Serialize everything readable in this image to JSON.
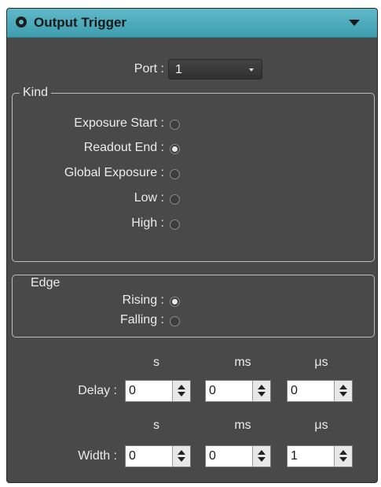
{
  "header": {
    "title": "Output Trigger",
    "icon": "gear-circle-icon",
    "collapse_icon": "triangle-down-icon"
  },
  "port": {
    "label": "Port :",
    "value": "1"
  },
  "kind": {
    "title": "Kind",
    "options": [
      {
        "label": "Exposure Start :",
        "selected": false
      },
      {
        "label": "Readout End :",
        "selected": true
      },
      {
        "label": "Global Exposure :",
        "selected": false
      },
      {
        "label": "Low :",
        "selected": false
      },
      {
        "label": "High :",
        "selected": false
      }
    ]
  },
  "edge": {
    "title": "Edge",
    "options": [
      {
        "label": "Rising :",
        "selected": true
      },
      {
        "label": "Falling :",
        "selected": false
      }
    ]
  },
  "units": [
    "s",
    "ms",
    "μs"
  ],
  "delay": {
    "label": "Delay :",
    "values": [
      "0",
      "0",
      "0"
    ]
  },
  "width": {
    "label": "Width :",
    "values": [
      "0",
      "0",
      "1"
    ]
  }
}
